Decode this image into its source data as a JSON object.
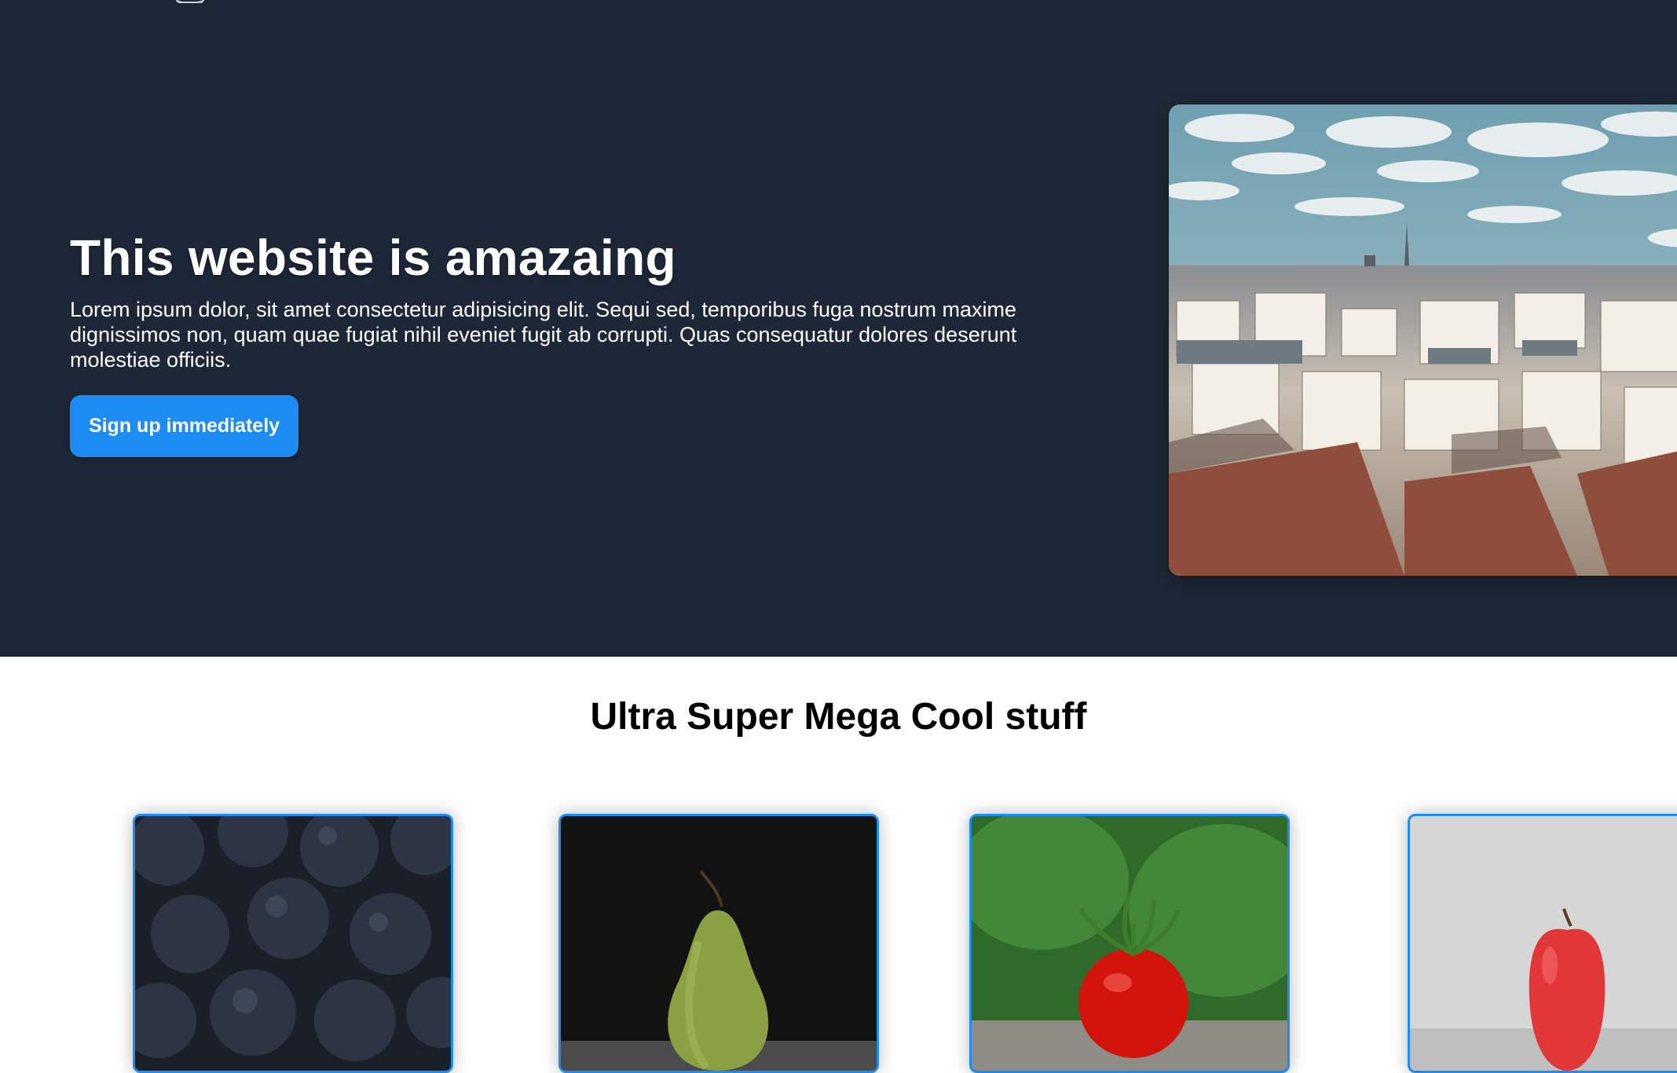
{
  "hero": {
    "title": "This website is amazaing",
    "body": "Lorem ipsum dolor, sit amet consectetur adipisicing elit. Sequi sed, temporibus fuga nostrum maxime dignissimos non, quam quae fugiat nihil eveniet fugit ab corrupti. Quas consequatur dolores deserunt molestiae officiis.",
    "cta_label": "Sign up immediately",
    "image_icon": "paris-rooftops-photo"
  },
  "products": {
    "title": "Ultra Super Mega Cool stuff",
    "cards": [
      {
        "icon": "blueberries-photo"
      },
      {
        "icon": "pear-photo"
      },
      {
        "icon": "tomato-photo"
      },
      {
        "icon": "apple-photo"
      }
    ]
  },
  "colors": {
    "hero_bg": "#1e2737",
    "accent": "#1e8cf5",
    "text_light": "#ffffff",
    "text_dark": "#000000"
  }
}
